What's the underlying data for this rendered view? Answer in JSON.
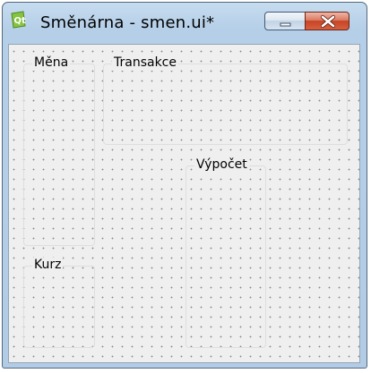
{
  "window": {
    "title": "Směnárna - smen.ui*",
    "icon": "qt-designer-icon"
  },
  "titlebar_buttons": {
    "minimize": "minimize-icon",
    "close": "close-icon",
    "close_color": "#c74426"
  },
  "form": {
    "groupboxes": [
      {
        "title": "Měna"
      },
      {
        "title": "Transakce"
      },
      {
        "title": "Výpočet"
      },
      {
        "title": "Kurz"
      }
    ]
  }
}
